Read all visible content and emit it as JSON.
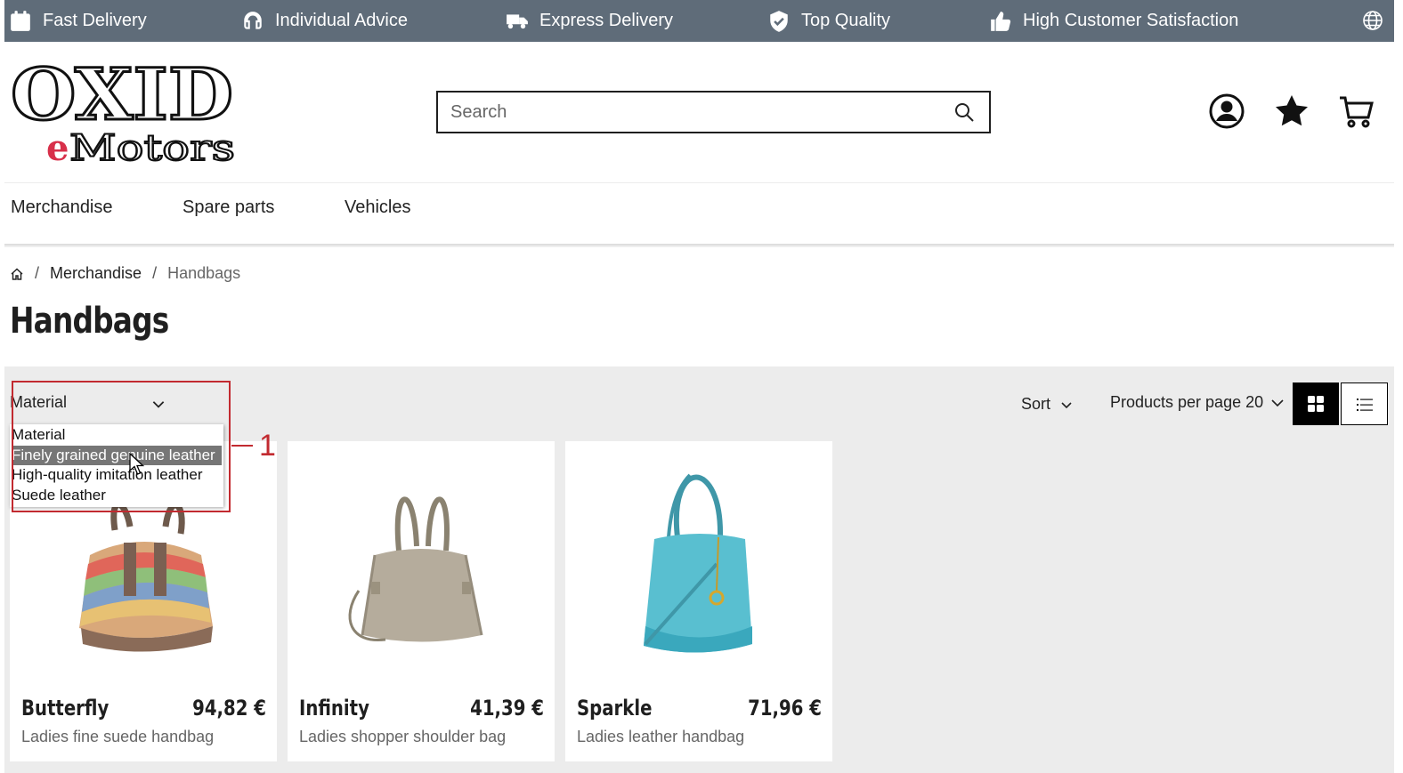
{
  "topbar": {
    "items": [
      {
        "icon": "calendar-icon",
        "label": "Fast Delivery"
      },
      {
        "icon": "headset-icon",
        "label": "Individual Advice"
      },
      {
        "icon": "truck-icon",
        "label": "Express Delivery"
      },
      {
        "icon": "shield-check-icon",
        "label": "Top Quality"
      },
      {
        "icon": "thumbs-up-icon",
        "label": "High Customer Satisfaction"
      }
    ],
    "language_icon": "globe-icon",
    "background": "#5f6c79"
  },
  "header": {
    "logo_text_main": "OXID",
    "logo_text_sub_accent": "e",
    "logo_text_sub": "Motors",
    "search_placeholder": "Search",
    "icons": [
      "account-icon",
      "wishlist-star-icon",
      "cart-icon"
    ]
  },
  "nav": {
    "items": [
      "Merchandise",
      "Spare parts",
      "Vehicles"
    ]
  },
  "breadcrumb": {
    "home_icon": "home-icon",
    "items": [
      "Merchandise",
      "Handbags"
    ]
  },
  "page": {
    "title": "Handbags"
  },
  "filters": {
    "material": {
      "label": "Material",
      "options": [
        "Material",
        "Finely grained genuine leather",
        "High-quality imitation leather",
        "Suede leather"
      ],
      "highlighted": "Finely grained genuine leather"
    },
    "sort_label": "Sort",
    "per_page_label": "Products per page 20"
  },
  "annotation": {
    "number": "1",
    "color": "#c22a30"
  },
  "products": [
    {
      "name": "Butterfly",
      "price": "94,82 €",
      "desc": "Ladies fine suede handbag"
    },
    {
      "name": "Infinity",
      "price": "41,39 €",
      "desc": "Ladies shopper shoulder bag"
    },
    {
      "name": "Sparkle",
      "price": "71,96 €",
      "desc": "Ladies leather handbag"
    }
  ]
}
